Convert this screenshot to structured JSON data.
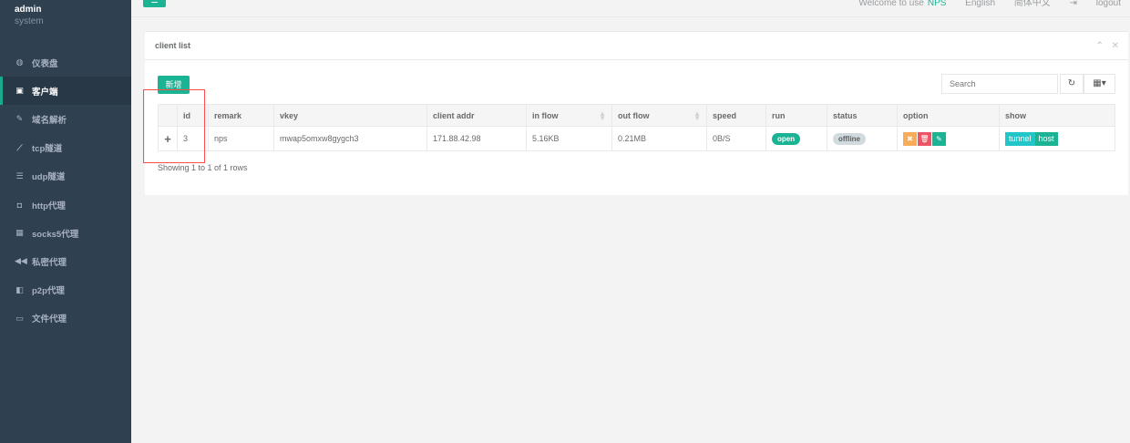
{
  "sidebar": {
    "user": "admin",
    "role": "system",
    "items": [
      {
        "label": "仪表盘",
        "icon": "dashboard-icon",
        "glyph": "◍",
        "active": false
      },
      {
        "label": "客户端",
        "icon": "clipboard-icon",
        "glyph": "▣",
        "active": true
      },
      {
        "label": "域名解析",
        "icon": "tag-icon",
        "glyph": "✎",
        "active": false
      },
      {
        "label": "tcp隧道",
        "icon": "line-chart-icon",
        "glyph": "⟋",
        "active": false
      },
      {
        "label": "udp隧道",
        "icon": "list-icon",
        "glyph": "☰",
        "active": false
      },
      {
        "label": "http代理",
        "icon": "shield-icon",
        "glyph": "◘",
        "active": false
      },
      {
        "label": "socks5代理",
        "icon": "table-icon",
        "glyph": "▦",
        "active": false
      },
      {
        "label": "私密代理",
        "icon": "backward-icon",
        "glyph": "◀◀",
        "active": false
      },
      {
        "label": "p2p代理",
        "icon": "p2p-icon",
        "glyph": "◧",
        "active": false
      },
      {
        "label": "文件代理",
        "icon": "laptop-icon",
        "glyph": "▭",
        "active": false
      }
    ]
  },
  "topbar": {
    "menu_glyph": "☰",
    "welcome": "Welcome to use",
    "brand": "NPS",
    "lang_en": "English",
    "lang_zh": "简体中文",
    "logout": "logout"
  },
  "panel": {
    "title": "client list",
    "collapse_glyph": "⌃",
    "close_glyph": "✕",
    "add_label": "新增",
    "search_placeholder": "Search",
    "refresh_glyph": "↻",
    "columns_glyph": "▦▾"
  },
  "table": {
    "headers": {
      "id": "id",
      "remark": "remark",
      "vkey": "vkey",
      "addr": "client addr",
      "inflow": "in flow",
      "outflow": "out flow",
      "speed": "speed",
      "run": "run",
      "status": "status",
      "option": "option",
      "show": "show"
    },
    "row": {
      "expand": "+",
      "id": "3",
      "remark": "nps",
      "vkey": "mwap5omxw8gygch3",
      "addr": "171.88.42.98",
      "inflow": "5.16KB",
      "outflow": "0.21MB",
      "speed": "0B/S",
      "run": "open",
      "status": "offline",
      "opt_stop": "✖",
      "opt_delete": "🗑",
      "opt_edit": "✎",
      "show_tunnel": "tunnel",
      "show_host": "host"
    },
    "footer": "Showing 1 to 1 of 1 rows"
  }
}
